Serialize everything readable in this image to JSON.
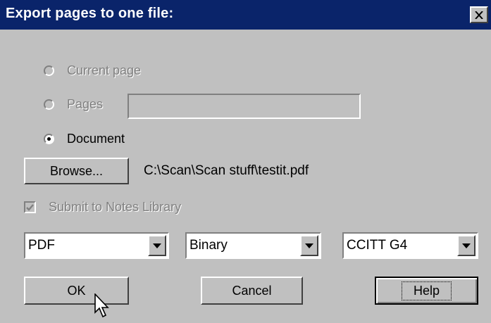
{
  "dialog": {
    "title": "Export pages to one file:",
    "close_glyph": "×"
  },
  "scope": {
    "current_page_label": "Current page",
    "pages_label": "Pages",
    "pages_value": "",
    "document_label": "Document",
    "selected": "Document"
  },
  "browse": {
    "button_label": "Browse...",
    "path": "C:\\Scan\\Scan stuff\\testit.pdf"
  },
  "submit": {
    "label": "Submit to Notes Library",
    "checked": true,
    "enabled": false
  },
  "combos": {
    "format": "PDF",
    "mode": "Binary",
    "compression": "CCITT G4"
  },
  "buttons": {
    "ok": "OK",
    "cancel": "Cancel",
    "help": "Help"
  },
  "colors": {
    "titlebar": "#0a246a",
    "face": "#c0c0c0"
  }
}
